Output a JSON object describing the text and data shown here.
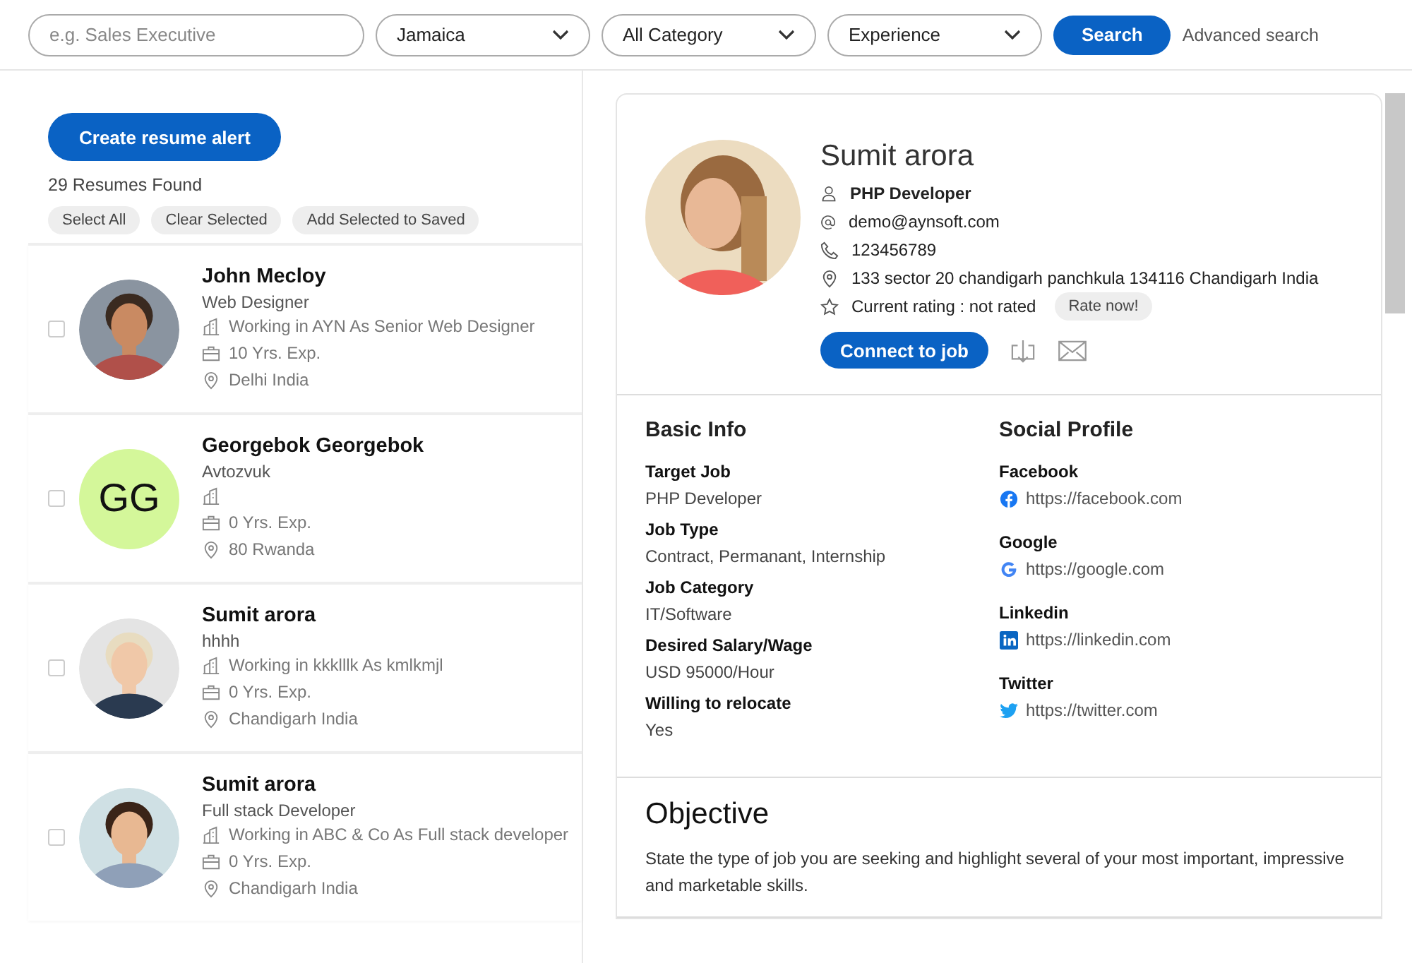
{
  "search_bar": {
    "keyword": {
      "placeholder": "e.g. Sales Executive"
    },
    "dropdowns": [
      {
        "value": "Jamaica"
      },
      {
        "value": "All Category"
      },
      {
        "value": "Experience"
      }
    ],
    "search_button": "Search",
    "advanced_link": "Advanced search"
  },
  "sidebar": {
    "alert_button": "Create resume alert",
    "count": "29 Resumes Found",
    "actions": [
      "Select All",
      "Clear Selected",
      "Add Selected to Saved"
    ],
    "candidates": [
      {
        "kind": "picture",
        "checked": false,
        "name": "John Mecloy",
        "title": "Web Designer",
        "work": "Working in AYN As Senior Web Designer",
        "experience": "10 Yrs. Exp.",
        "location": "Delhi India"
      },
      {
        "kind": "initials",
        "initials": "GG",
        "color": "#d4f79a",
        "checked": false,
        "name": "Georgebok Georgebok",
        "title": "Avtozvuk",
        "experience": "0 Yrs. Exp.",
        "location": "80 Rwanda"
      },
      {
        "kind": "picture",
        "checked": false,
        "name": "Sumit arora",
        "title": "hhhh",
        "work": "Working in kkklllk As kmlkmjl",
        "experience": "0 Yrs. Exp.",
        "location": "Chandigarh India"
      },
      {
        "kind": "picture",
        "checked": false,
        "name": "Sumit arora",
        "title": "Full stack Developer",
        "work": "Working in ABC & Co As Full stack developer",
        "experience": "0 Yrs. Exp.",
        "location": "Chandigarh India"
      }
    ]
  },
  "profile": {
    "name": "Sumit arora",
    "role": "PHP Developer",
    "email": "demo@aynsoft.com",
    "phone": "123456789",
    "address": "133 sector 20 chandigarh panchkula 134116 Chandigarh India",
    "rating": "Current rating : not rated",
    "rate_button": "Rate now!",
    "connect_button": "Connect to job",
    "basic_info": {
      "title": "Basic Info",
      "fields": [
        {
          "label": "Target Job",
          "value": "PHP Developer"
        },
        {
          "label": "Job Type",
          "value": "Contract, Permanant, Internship"
        },
        {
          "label": "Job Category",
          "value": "IT/Software"
        },
        {
          "label": "Desired Salary/Wage",
          "value": "USD 95000/Hour"
        },
        {
          "label": "Willing to relocate",
          "value": "Yes"
        }
      ]
    },
    "social_profile": {
      "title": "Social Profile",
      "links": [
        {
          "kind": "facebook",
          "label": "Facebook",
          "url": "https://facebook.com"
        },
        {
          "kind": "google",
          "label": "Google",
          "url": "https://google.com"
        },
        {
          "kind": "linkedin",
          "label": "Linkedin",
          "url": "https://linkedin.com"
        },
        {
          "kind": "twitter",
          "label": "Twitter",
          "url": "https://twitter.com"
        }
      ]
    },
    "objective": {
      "title": "Objective",
      "text": "State the type of job you are seeking and highlight several of your most important, impressive and marketable skills."
    }
  }
}
